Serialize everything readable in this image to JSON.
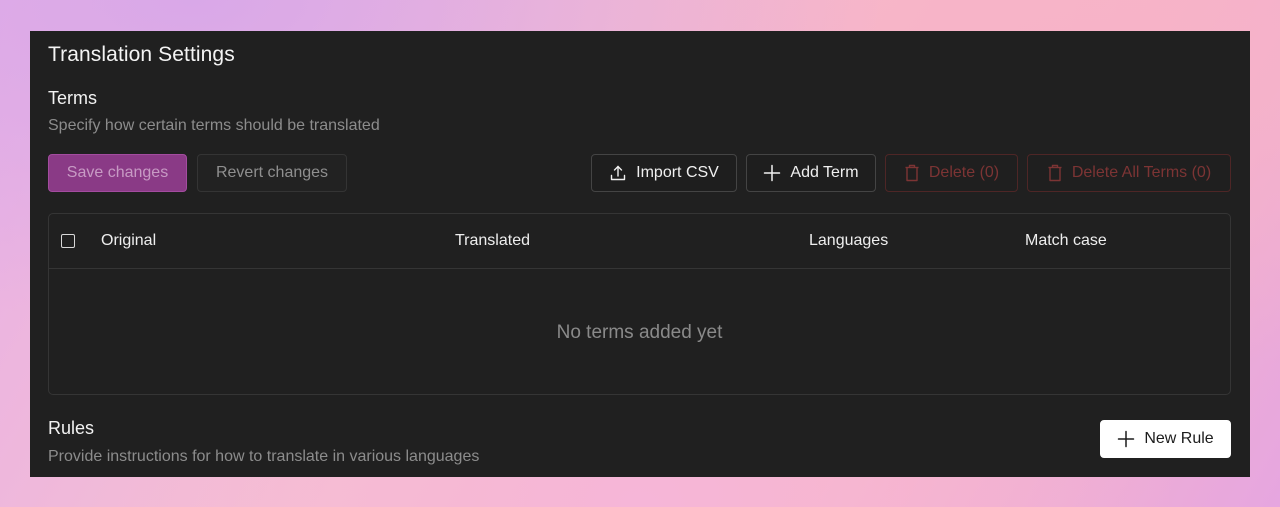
{
  "page": {
    "title": "Translation Settings"
  },
  "terms": {
    "title": "Terms",
    "description": "Specify how certain terms should be translated",
    "save_label": "Save changes",
    "revert_label": "Revert changes",
    "import_label": "Import CSV",
    "add_label": "Add Term",
    "delete_label": "Delete (0)",
    "delete_all_label": "Delete All Terms (0)",
    "table": {
      "columns": [
        "Original",
        "Translated",
        "Languages",
        "Match case"
      ],
      "rows": [],
      "empty_message": "No terms added yet"
    }
  },
  "rules": {
    "title": "Rules",
    "description": "Provide instructions for how to translate in various languages",
    "new_rule_label": "New Rule"
  },
  "icons": {
    "import": "upload-icon",
    "add": "plus-icon",
    "delete": "trash-icon"
  },
  "colors": {
    "panel_background": "#202020",
    "primary_accent": "#8a3a86",
    "danger": "#7c3434",
    "muted_text": "#8c8c8c"
  }
}
